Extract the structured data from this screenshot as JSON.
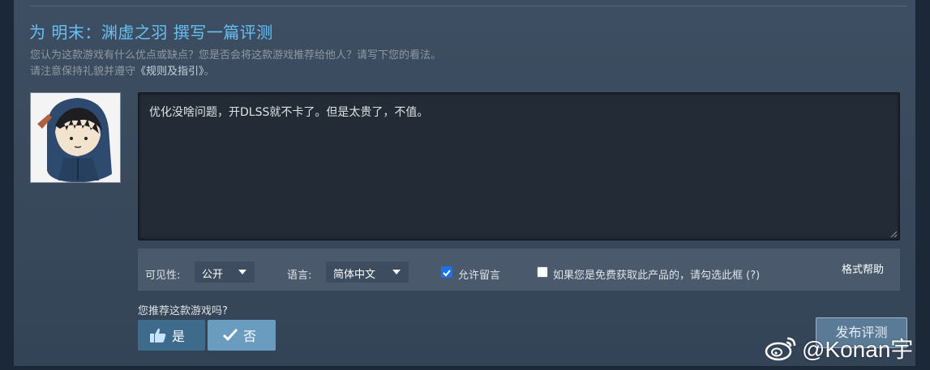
{
  "header": {
    "title": "为 明末：渊虚之羽 撰写一篇评测",
    "subtitle_line1": "您认为这款游戏有什么优点或缺点？您是否会将这款游戏推荐给他人？请写下您的看法。",
    "subtitle_line2_prefix": "请注意保持礼貌并遵守",
    "guidelines_link": "《规则及指引》",
    "subtitle_line2_suffix": "。"
  },
  "review": {
    "text": "优化没啥问题，开DLSS就不卡了。但是太贵了，不值。"
  },
  "options": {
    "visibility_label": "可见性:",
    "visibility_value": "公开",
    "language_label": "语言:",
    "language_value": "简体中文",
    "allow_comments_label": "允许留言",
    "allow_comments_checked": true,
    "free_product_label": "如果您是免费获取此产品的，请勾选此框 (?)",
    "free_product_checked": false,
    "format_help": "格式帮助"
  },
  "recommend": {
    "question": "您推荐这款游戏吗?",
    "yes_label": "是",
    "no_label": "否",
    "selected": "no"
  },
  "publish_label": "发布评测",
  "watermark": "@Konan宇",
  "colors": {
    "accent": "#66c0f4",
    "panel": "#3d4e62",
    "textbox": "#222b36",
    "checkbox_checked": "#1a73e8"
  }
}
